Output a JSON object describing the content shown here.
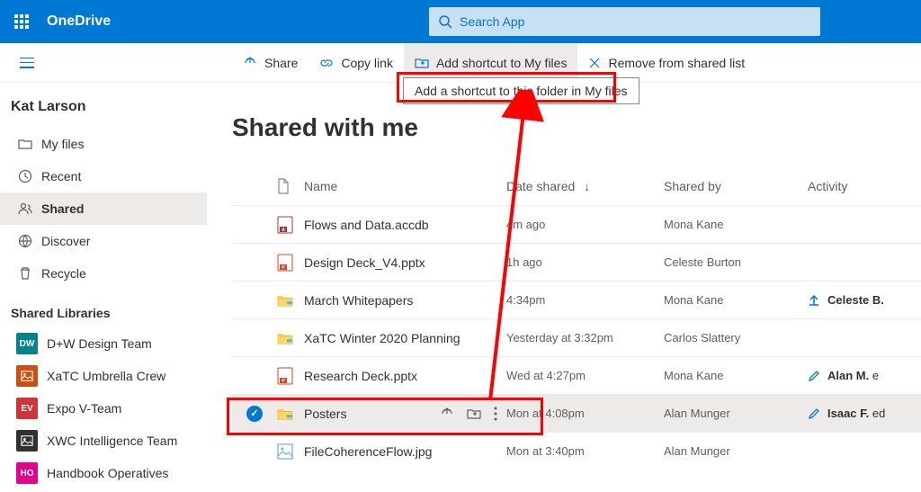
{
  "header": {
    "brand": "OneDrive",
    "search_placeholder": "Search App"
  },
  "commands": {
    "share": "Share",
    "copy_link": "Copy link",
    "add_shortcut": "Add shortcut to My files",
    "remove": "Remove from shared list",
    "tooltip": "Add a shortcut to this folder in My files"
  },
  "sidebar": {
    "user": "Kat Larson",
    "nav": [
      {
        "label": "My files"
      },
      {
        "label": "Recent"
      },
      {
        "label": "Shared"
      },
      {
        "label": "Discover"
      },
      {
        "label": "Recycle"
      }
    ],
    "libraries_title": "Shared Libraries",
    "libraries": [
      {
        "badge": "DW",
        "color": "#038387",
        "label": "D+W Design Team"
      },
      {
        "badge": "🖼",
        "color": "#ca5010",
        "label": "XaTC Umbrella Crew",
        "type": "img"
      },
      {
        "badge": "EV",
        "color": "#d13438",
        "label": "Expo V-Team"
      },
      {
        "badge": "🖼",
        "color": "#323130",
        "label": "XWC Intelligence Team",
        "type": "img"
      },
      {
        "badge": "HO",
        "color": "#e3008c",
        "label": "Handbook Operatives"
      }
    ]
  },
  "main": {
    "title": "Shared with me",
    "columns": {
      "name": "Name",
      "date": "Date shared",
      "shared_by": "Shared by",
      "activity": "Activity"
    },
    "rows": [
      {
        "icon": "db",
        "name": "Flows and Data.accdb",
        "date": "4m ago",
        "by": "Mona Kane",
        "activity": null
      },
      {
        "icon": "ppt",
        "name": "Design Deck_V4.pptx",
        "date": "1h ago",
        "by": "Celeste Burton",
        "activity": null
      },
      {
        "icon": "sharedfolder",
        "name": "March Whitepapers",
        "date": "4:34pm",
        "by": "Mona Kane",
        "activity": {
          "icon": "upload",
          "text": "Celeste B."
        }
      },
      {
        "icon": "sharedfolder",
        "name": "XaTC Winter 2020 Planning",
        "date": "Yesterday at 3:32pm",
        "by": "Carlos Slattery",
        "activity": null
      },
      {
        "icon": "ppt",
        "name": "Research Deck.pptx",
        "date": "Wed at 4:27pm",
        "by": "Mona Kane",
        "activity": {
          "icon": "edit",
          "text": "Alan M.",
          "suffix": " e"
        }
      },
      {
        "icon": "sharedfolder",
        "name": "Posters",
        "date": "Mon at 4:08pm",
        "by": "Alan Munger",
        "selected": true,
        "showActions": true,
        "activity": {
          "icon": "edit",
          "text": "Isaac F.",
          "suffix": " ed"
        }
      },
      {
        "icon": "image",
        "name": "FileCoherenceFlow.jpg",
        "date": "Mon at 3:40pm",
        "by": "Alan Munger",
        "activity": null
      }
    ]
  }
}
